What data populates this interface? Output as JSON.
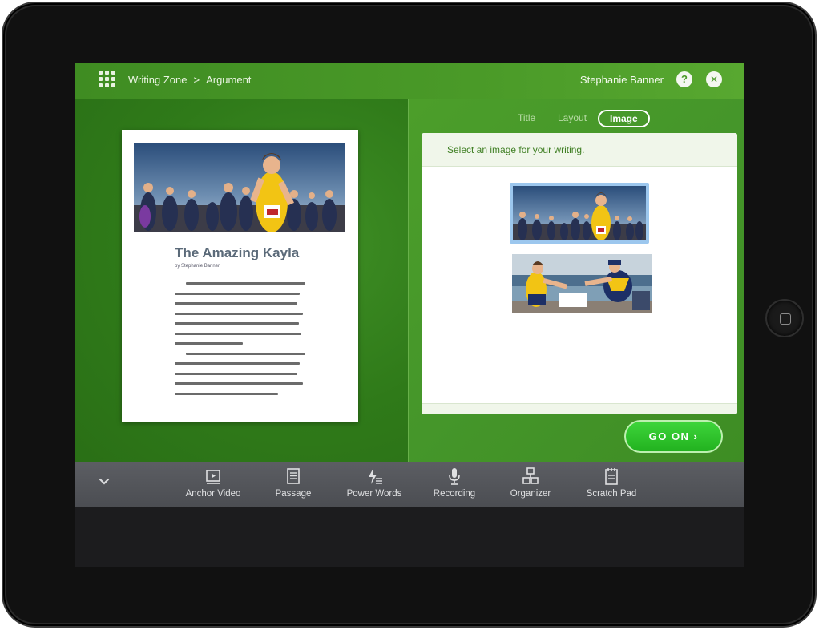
{
  "header": {
    "breadcrumb": [
      "Writing Zone",
      "Argument"
    ],
    "separator": ">",
    "user_name": "Stephanie Banner",
    "help_symbol": "?",
    "close_symbol": "✕"
  },
  "document": {
    "title": "The Amazing Kayla",
    "byline": "by Stephanie Banner",
    "photo_icon": "runners-photo"
  },
  "right_panel": {
    "tabs": [
      {
        "label": "Title",
        "active": false
      },
      {
        "label": "Layout",
        "active": false
      },
      {
        "label": "Image",
        "active": true
      }
    ],
    "instruction": "Select an image for your writing.",
    "images": [
      {
        "name": "runners-race-photo",
        "selected": true
      },
      {
        "name": "runner-coach-photo",
        "selected": false
      }
    ],
    "go_on_label": "GO ON ›"
  },
  "toolbar": {
    "items": [
      {
        "label": "Anchor Video",
        "icon": "video-icon"
      },
      {
        "label": "Passage",
        "icon": "document-icon"
      },
      {
        "label": "Power Words",
        "icon": "lightning-icon"
      },
      {
        "label": "Recording",
        "icon": "microphone-icon"
      },
      {
        "label": "Organizer",
        "icon": "organizer-icon"
      },
      {
        "label": "Scratch Pad",
        "icon": "notepad-icon"
      }
    ]
  },
  "colors": {
    "brand_green": "#4a9a28",
    "go_button": "#2fc42c",
    "selection_blue": "#9cc7ee",
    "toolbar": "#55575c"
  }
}
